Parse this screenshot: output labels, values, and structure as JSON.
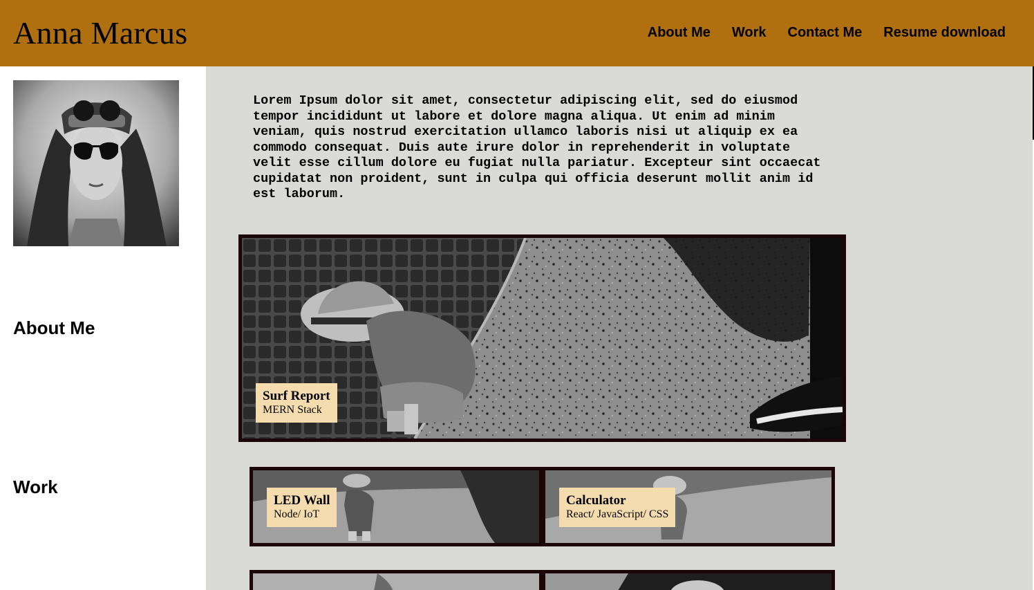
{
  "header": {
    "title": "Anna Marcus",
    "nav": [
      "About Me",
      "Work",
      "Contact Me",
      "Resume download"
    ],
    "background": "#b07010"
  },
  "sidebar": {
    "avatar": "portrait-photo",
    "headings": [
      "About Me",
      "Work"
    ]
  },
  "main": {
    "intro": "Lorem Ipsum dolor sit amet, consectetur adipiscing elit, sed do eiusmod tempor incididunt ut labore et dolore magna aliqua. Ut enim ad minim veniam, quis nostrud exercitation ullamco laboris nisi ut aliquip ex ea commodo consequat. Duis aute irure dolor in reprehenderit in voluptate velit esse cillum dolore eu fugiat nulla pariatur. Excepteur sint occaecat cupidatat non proident, sunt in culpa qui officia deserunt mollit anim id est laborum.",
    "background": "#dadad6"
  },
  "projects": [
    {
      "title": "Surf Report",
      "stack": "MERN Stack"
    },
    {
      "title": "LED Wall",
      "stack": "Node/ IoT"
    },
    {
      "title": "Calculator",
      "stack": "React/ JavaScript/ CSS"
    }
  ],
  "colors": {
    "label_background": "#f5dcae",
    "card_border": "#1c0508"
  }
}
